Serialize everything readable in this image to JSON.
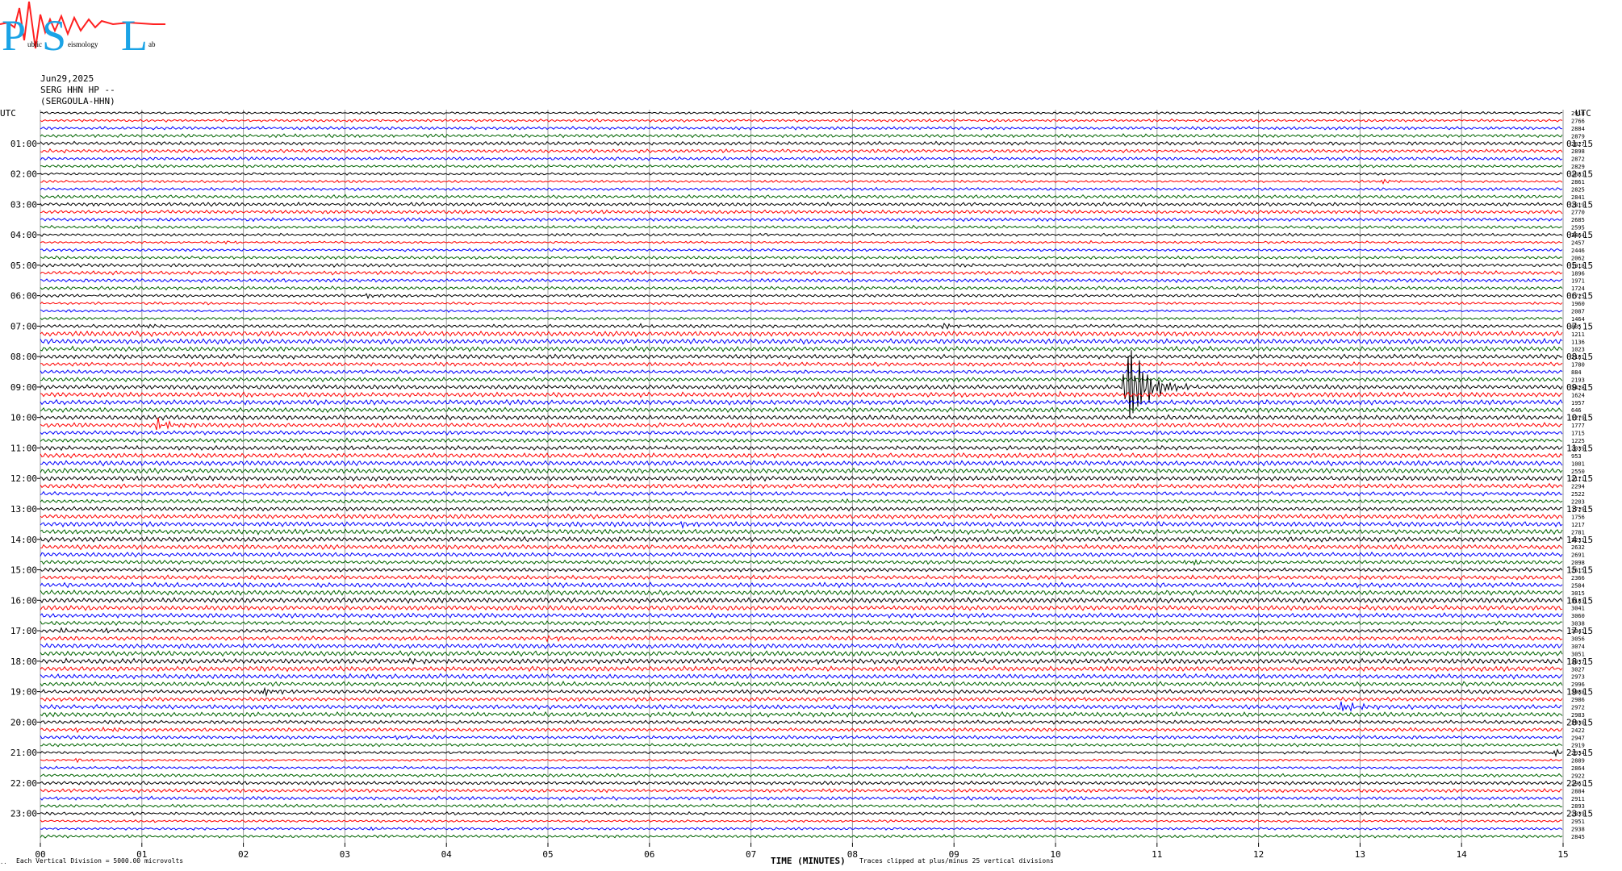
{
  "logo": {
    "letters": [
      "P",
      "S",
      "L"
    ],
    "small_text": [
      "ublic",
      "eismology",
      "ab"
    ]
  },
  "header": {
    "date": "Jun29,2025",
    "channel": "SERG HHN HP --",
    "site": "(SERGOULA-HHN)"
  },
  "footer": {
    "mark": "..",
    "left": "Each Vertical Division = 5000.00 microvolts",
    "xlabel": "TIME (MINUTES)",
    "clip_note": "Traces clipped at plus/minus 25 vertical divisions"
  },
  "chart_data": {
    "type": "helicorder",
    "xlabel": "TIME (MINUTES)",
    "xlim": [
      0,
      15
    ],
    "x_ticks": [
      "00",
      "01",
      "02",
      "03",
      "04",
      "05",
      "06",
      "07",
      "08",
      "09",
      "10",
      "11",
      "12",
      "13",
      "14",
      "15"
    ],
    "left_axis_title": "UTC",
    "right_axis_title": "UTC",
    "left_hour_labels": [
      "01:00",
      "02:00",
      "03:00",
      "04:00",
      "05:00",
      "06:00",
      "07:00",
      "08:00",
      "09:00",
      "10:00",
      "11:00",
      "12:00",
      "13:00",
      "14:00",
      "15:00",
      "16:00",
      "17:00",
      "18:00",
      "19:00",
      "20:00",
      "21:00",
      "22:00",
      "23:00"
    ],
    "right_hour_labels": [
      "01:15",
      "02:15",
      "03:15",
      "04:15",
      "05:15",
      "06:15",
      "07:15",
      "08:15",
      "09:15",
      "10:15",
      "11:15",
      "12:15",
      "13:15",
      "14:15",
      "15:15",
      "16:15",
      "17:15",
      "18:15",
      "19:15",
      "20:15",
      "21:15",
      "22:15",
      "23:15"
    ],
    "trace_colors": [
      "#000000",
      "#ff0000",
      "#0000ff",
      "#006400"
    ],
    "trace_values": [
      "2918",
      "2766",
      "2884",
      "2879",
      "2827",
      "2898",
      "2872",
      "2829",
      "2883",
      "2861",
      "2825",
      "2841",
      "2819",
      "2770",
      "2685",
      "2595",
      "2464",
      "2457",
      "2446",
      "2062",
      "1918",
      "1896",
      "1971",
      "1724",
      "1725",
      "1960",
      "2087",
      "1464",
      "885",
      "1211",
      "1136",
      "1023",
      "2101",
      "1780",
      "884",
      "2193",
      "2428",
      "1624",
      "1957",
      "646",
      "1279",
      "1777",
      "1715",
      "1225",
      "2039",
      "953",
      "1001",
      "2550",
      "2171",
      "2294",
      "2522",
      "2203",
      "1729",
      "1756",
      "1217",
      "2781",
      "2231",
      "2632",
      "2691",
      "2098",
      "2615",
      "2366",
      "2584",
      "3015",
      "3183",
      "3041",
      "3060",
      "3038",
      "3041",
      "3056",
      "3074",
      "3051",
      "3037",
      "3027",
      "2973",
      "2996",
      "2988",
      "2986",
      "2972",
      "2983",
      "2930",
      "2422",
      "2947",
      "2919",
      "2934",
      "2889",
      "2864",
      "2922",
      "2961",
      "2884",
      "2911",
      "2893",
      "2839",
      "2951",
      "2938",
      "2845"
    ],
    "events": [
      {
        "trace": 6,
        "minute": 10.05,
        "amp": 0.9
      },
      {
        "trace": 9,
        "minute": 13.2,
        "amp": 2.5
      },
      {
        "trace": 12,
        "minute": 0.5,
        "amp": 1.5
      },
      {
        "trace": 13,
        "minute": 5.45,
        "amp": 0.5
      },
      {
        "trace": 17,
        "minute": 1.8,
        "amp": 1.5
      },
      {
        "trace": 17,
        "minute": 10.3,
        "amp": 1.0
      },
      {
        "trace": 21,
        "minute": 6.4,
        "amp": 0.8
      },
      {
        "trace": 22,
        "minute": 11.2,
        "amp": 0.9
      },
      {
        "trace": 22,
        "minute": 13.1,
        "amp": 1.8
      },
      {
        "trace": 24,
        "minute": 3.2,
        "amp": 2.5
      },
      {
        "trace": 25,
        "minute": 7.0,
        "amp": 1.0
      },
      {
        "trace": 26,
        "minute": 8.9,
        "amp": 1.5
      },
      {
        "trace": 26,
        "minute": 9.5,
        "amp": 1.0
      },
      {
        "trace": 28,
        "minute": 1.0,
        "amp": 2.0
      },
      {
        "trace": 28,
        "minute": 5.9,
        "amp": 1.5
      },
      {
        "trace": 28,
        "minute": 8.9,
        "amp": 3.5
      },
      {
        "trace": 33,
        "minute": 4.7,
        "amp": 1.0
      },
      {
        "trace": 35,
        "minute": 7.3,
        "amp": 1.2
      },
      {
        "trace": 35,
        "minute": 8.9,
        "amp": 1.2
      },
      {
        "trace": 36,
        "minute": 10.7,
        "amp": 60
      },
      {
        "trace": 37,
        "minute": 10.0,
        "amp": 1.0
      },
      {
        "trace": 39,
        "minute": 11.2,
        "amp": 1.5
      },
      {
        "trace": 41,
        "minute": 1.15,
        "amp": 7
      },
      {
        "trace": 47,
        "minute": 14.0,
        "amp": 1.2
      },
      {
        "trace": 51,
        "minute": 7.9,
        "amp": 1.8
      },
      {
        "trace": 54,
        "minute": 6.3,
        "amp": 3.5
      },
      {
        "trace": 55,
        "minute": 2.0,
        "amp": 0.8
      },
      {
        "trace": 59,
        "minute": 11.3,
        "amp": 4
      },
      {
        "trace": 62,
        "minute": 7.6,
        "amp": 0.8
      },
      {
        "trace": 64,
        "minute": 13.2,
        "amp": 1.2
      },
      {
        "trace": 67,
        "minute": 2.1,
        "amp": 1.5
      },
      {
        "trace": 67,
        "minute": 7.8,
        "amp": 1.0
      },
      {
        "trace": 68,
        "minute": 0.2,
        "amp": 2.0
      },
      {
        "trace": 68,
        "minute": 0.6,
        "amp": 2.0
      },
      {
        "trace": 68,
        "minute": 9.8,
        "amp": 1.2
      },
      {
        "trace": 69,
        "minute": 3.6,
        "amp": 1.2
      },
      {
        "trace": 69,
        "minute": 5.0,
        "amp": 2.0
      },
      {
        "trace": 72,
        "minute": 3.6,
        "amp": 2.5
      },
      {
        "trace": 72,
        "minute": 7.6,
        "amp": 1.5
      },
      {
        "trace": 75,
        "minute": 5.1,
        "amp": 1.0
      },
      {
        "trace": 75,
        "minute": 13.9,
        "amp": 1.5
      },
      {
        "trace": 76,
        "minute": 2.2,
        "amp": 4
      },
      {
        "trace": 77,
        "minute": 10.2,
        "amp": 1.0
      },
      {
        "trace": 78,
        "minute": 12.8,
        "amp": 6
      },
      {
        "trace": 81,
        "minute": 0.3,
        "amp": 2.0
      },
      {
        "trace": 81,
        "minute": 0.65,
        "amp": 2.5
      },
      {
        "trace": 82,
        "minute": 3.45,
        "amp": 2.0
      },
      {
        "trace": 82,
        "minute": 7.8,
        "amp": 1.8
      },
      {
        "trace": 84,
        "minute": 3.0,
        "amp": 1.5
      },
      {
        "trace": 84,
        "minute": 14.9,
        "amp": 3.5
      },
      {
        "trace": 85,
        "minute": 0.3,
        "amp": 2.0
      },
      {
        "trace": 94,
        "minute": 3.25,
        "amp": 1.5
      }
    ]
  }
}
